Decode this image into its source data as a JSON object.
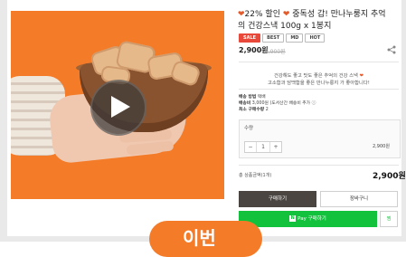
{
  "product": {
    "title_line1": "22% 할인",
    "title_line1b": "중독성 갑! 만나누룽지 추억",
    "title_line2": "의 건강스낵 100g x 1봉지",
    "heart_glyph": "❤",
    "heart_color": "#e35a2b",
    "badges": [
      "SALE",
      "BEST",
      "MD",
      "HOT"
    ],
    "price": "2,900원",
    "original_price": "3,900원"
  },
  "promo": {
    "line1": "건강해도 좋고 맛도 좋은 추억의 건강 스낵",
    "line2": "고소함과 담백함을 좋은 만나누룽지 가 좋아합니다!"
  },
  "info": {
    "shipping_method_label": "배송 방법",
    "shipping_method_value": "택배",
    "shipping_fee_label": "배송비",
    "shipping_fee_value": "3,000원 (도서산간 배송비 추가 ⓘ",
    "min_qty_label": "최소 구매수량",
    "min_qty_value": "2"
  },
  "quantity": {
    "label": "수량",
    "minus": "−",
    "value": "1",
    "plus": "+",
    "line_price": "2,900원"
  },
  "total": {
    "label": "총 상품금액(1개)",
    "price": "2,900원"
  },
  "buttons": {
    "buy": "구매하기",
    "cart": "장바구니",
    "npay_logo": "N",
    "npay": "Pay 구매하기",
    "wish": "찜"
  },
  "overlay": {
    "text": "이번"
  },
  "colors": {
    "accent_orange": "#f47b28",
    "npay_green": "#13c23c",
    "buy_dark": "#4a4541",
    "sale_red": "#e8493a"
  },
  "icons": {
    "play": "play-icon",
    "share": "share-icon"
  }
}
